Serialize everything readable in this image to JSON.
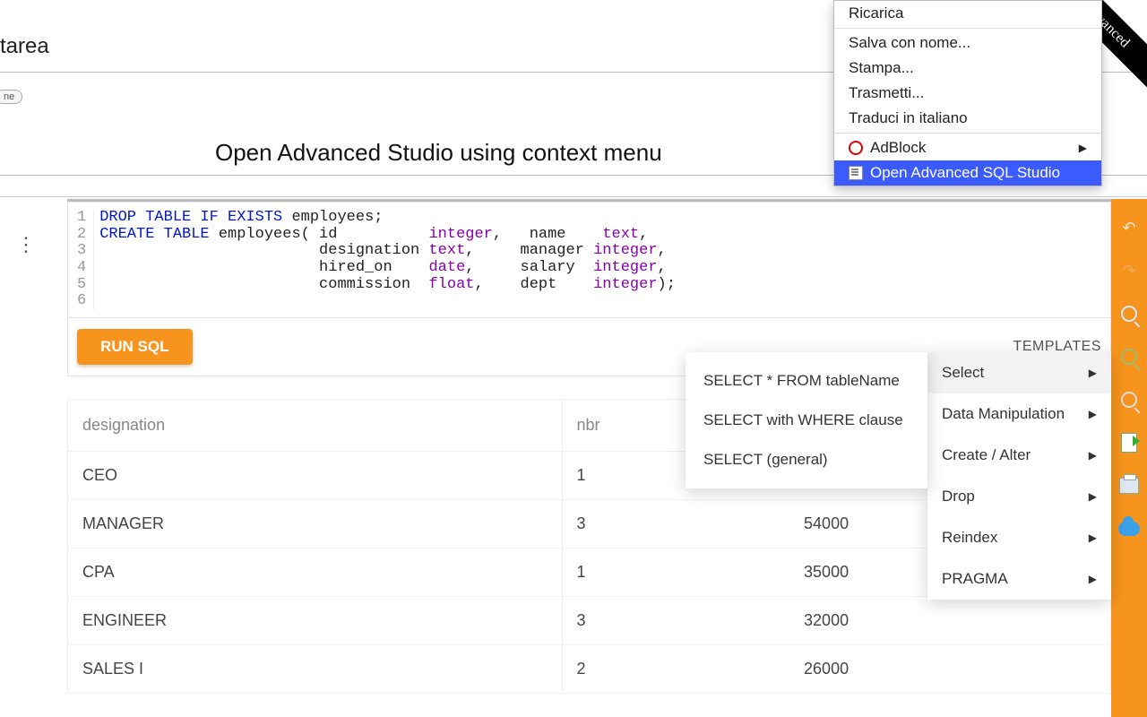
{
  "top": {
    "partial_text": "tarea",
    "pill": "ne",
    "caption": "Open Advanced Studio using context menu",
    "ribbon": "dvanced"
  },
  "context_menu": {
    "items": [
      "Ricarica",
      "Salva con nome...",
      "Stampa...",
      "Trasmetti...",
      "Traduci in italiano"
    ],
    "adblock": "AdBlock",
    "open_studio": "Open Advanced SQL Studio"
  },
  "editor": {
    "line_numbers": [
      "1",
      "2",
      "3",
      "4",
      "5",
      "6"
    ],
    "code_html": "<span class='kw'>DROP TABLE IF EXISTS</span> employees;<br><span class='kw'>CREATE TABLE</span> employees( id          <span class='ty'>integer</span>,   name    <span class='ty'>text</span>,<br>                        designation <span class='ty'>text</span>,     manager <span class='ty'>integer</span>,<br>                        hired_on    <span class='ty'>date</span>,     salary  <span class='ty'>integer</span>,<br>                        commission  <span class='ty'>float</span>,    dept    <span class='ty'>integer</span>);<br>&nbsp;"
  },
  "actions": {
    "run": "RUN SQL",
    "templates": "TEMPLATES"
  },
  "table": {
    "headers": [
      "designation",
      "nbr",
      ""
    ],
    "rows": [
      [
        "CEO",
        "1",
        ""
      ],
      [
        "MANAGER",
        "3",
        "54000"
      ],
      [
        "CPA",
        "1",
        "35000"
      ],
      [
        "ENGINEER",
        "3",
        "32000"
      ],
      [
        "SALES I",
        "2",
        "26000"
      ]
    ]
  },
  "templates_menu": {
    "items": [
      "Select",
      "Data Manipulation",
      "Create / Alter",
      "Drop",
      "Reindex",
      "PRAGMA"
    ],
    "submenu": [
      "SELECT * FROM tableName",
      "SELECT with WHERE clause",
      "SELECT (general)"
    ]
  }
}
